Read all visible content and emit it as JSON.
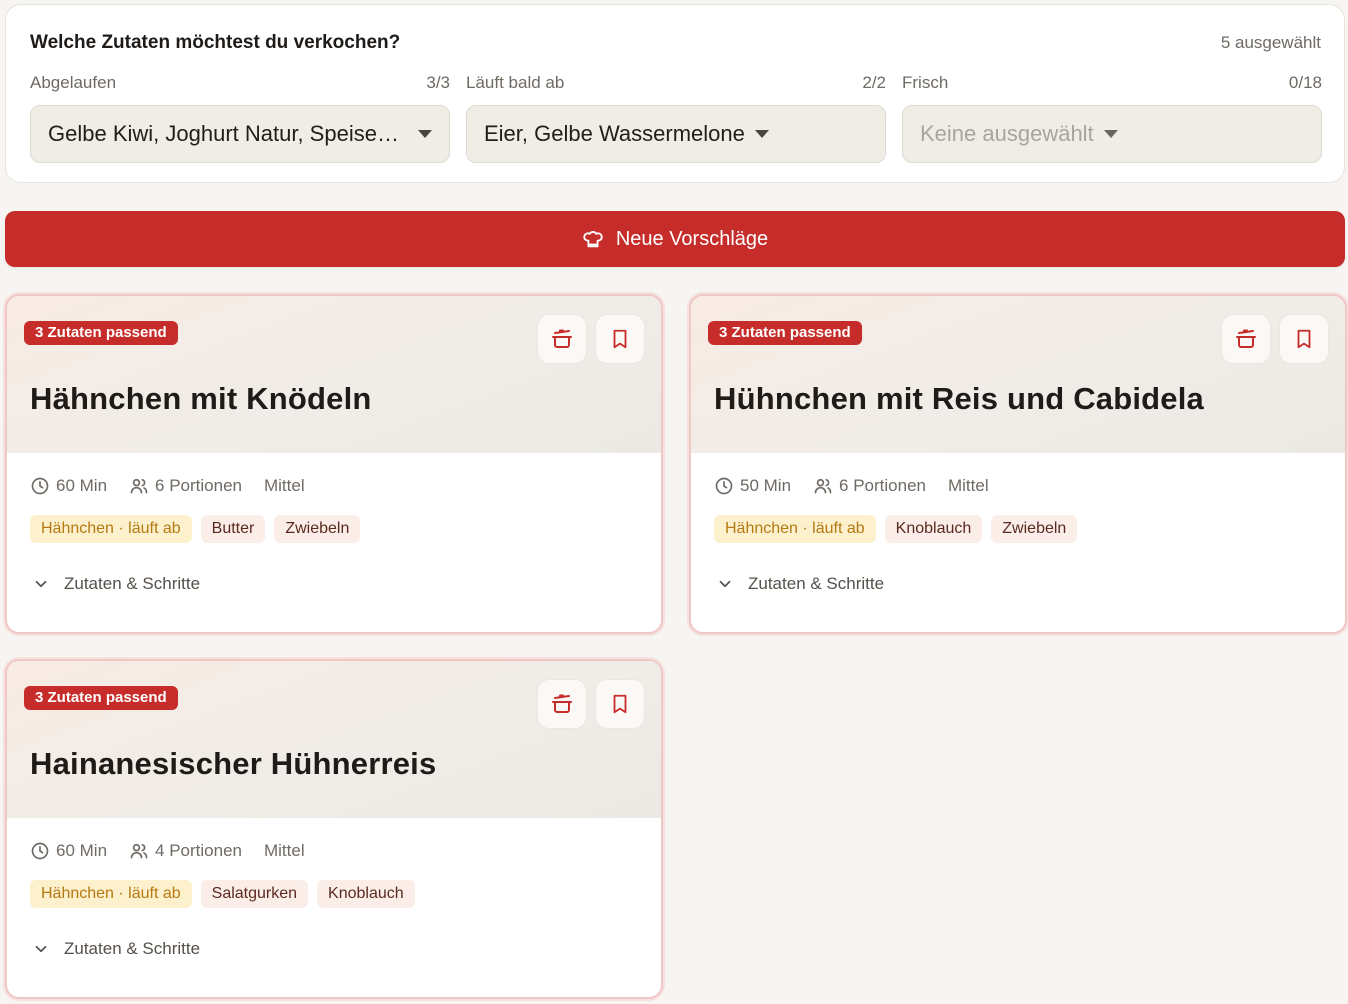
{
  "panel": {
    "title": "Welche Zutaten möchtest du verkochen?",
    "selected_count": "5 ausgewählt",
    "groups": [
      {
        "label": "Abgelaufen",
        "count": "3/3",
        "value": "Gelbe Kiwi, Joghurt Natur, Speise…",
        "placeholder": false
      },
      {
        "label": "Läuft bald ab",
        "count": "2/2",
        "value": "Eier, Gelbe Wassermelone",
        "placeholder": false
      },
      {
        "label": "Frisch",
        "count": "0/18",
        "value": "Keine ausgewählt",
        "placeholder": true
      }
    ]
  },
  "cta": {
    "label": "Neue Vorschläge",
    "icon": "chef-hat-icon",
    "color": "#c62d2a"
  },
  "recipes": [
    {
      "badge": "3 Zutaten passend",
      "title": "Hähnchen mit Knödeln",
      "time": "60 Min",
      "servings": "6 Portionen",
      "difficulty": "Mittel",
      "tags": [
        {
          "label": "Hähnchen · läuft ab",
          "warn": true
        },
        {
          "label": "Butter",
          "warn": false
        },
        {
          "label": "Zwiebeln",
          "warn": false
        }
      ],
      "expander": "Zutaten & Schritte"
    },
    {
      "badge": "3 Zutaten passend",
      "title": "Hühnchen mit Reis und Cabidela",
      "time": "50 Min",
      "servings": "6 Portionen",
      "difficulty": "Mittel",
      "tags": [
        {
          "label": "Hähnchen · läuft ab",
          "warn": true
        },
        {
          "label": "Knoblauch",
          "warn": false
        },
        {
          "label": "Zwiebeln",
          "warn": false
        }
      ],
      "expander": "Zutaten & Schritte"
    },
    {
      "badge": "3 Zutaten passend",
      "title": "Hainanesischer Hühnerreis",
      "time": "60 Min",
      "servings": "4 Portionen",
      "difficulty": "Mittel",
      "tags": [
        {
          "label": "Hähnchen · läuft ab",
          "warn": true
        },
        {
          "label": "Salatgurken",
          "warn": false
        },
        {
          "label": "Knoblauch",
          "warn": false
        }
      ],
      "expander": "Zutaten & Schritte"
    }
  ]
}
